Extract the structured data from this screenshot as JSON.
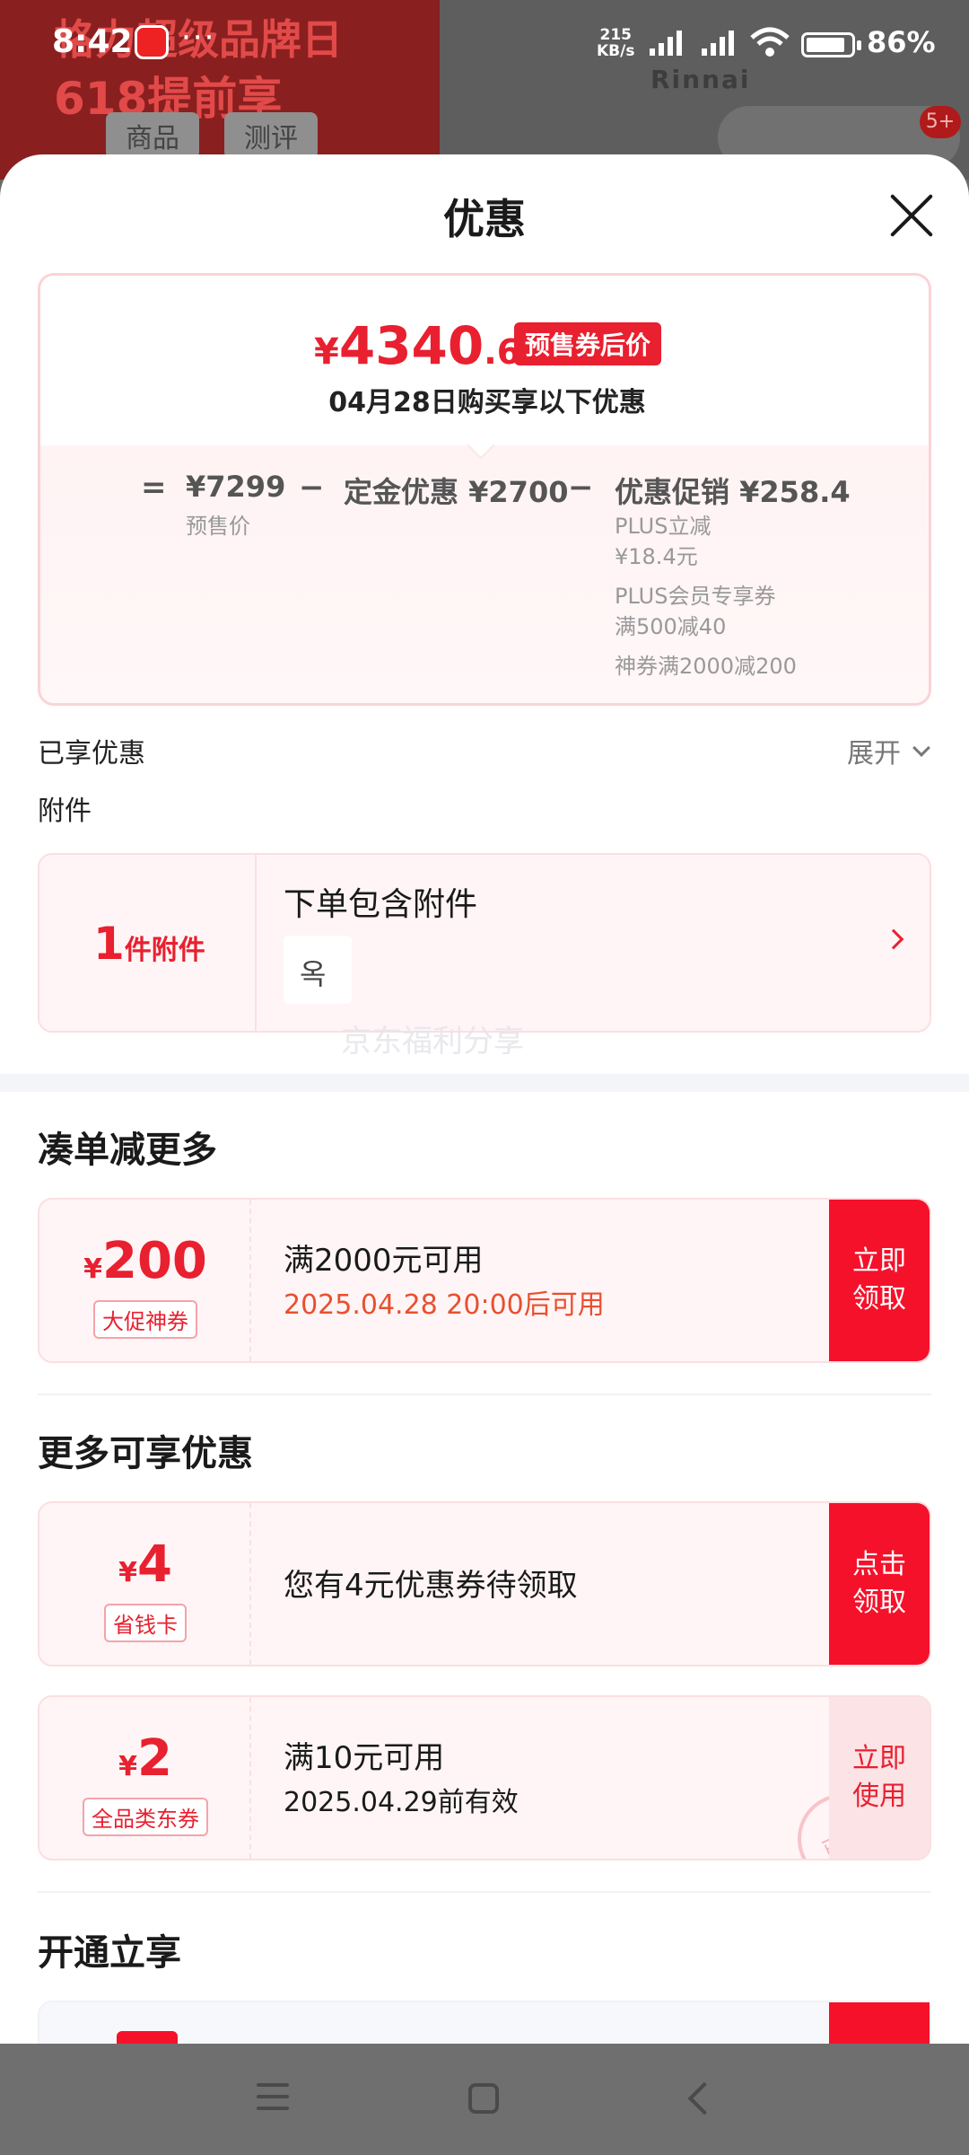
{
  "status_bar": {
    "time": "8:42",
    "more": "···",
    "net_speed_value": "215",
    "net_speed_unit": "KB/s",
    "battery": "86%"
  },
  "background": {
    "banner_line1": "格力超级品牌日",
    "banner_line2": "618提前享",
    "brand": "Rinnai",
    "tab1": "商品",
    "tab2": "测评",
    "badge": "5+"
  },
  "sheet": {
    "title": "优惠",
    "summary": {
      "currency": "¥",
      "price_int": "4340",
      "price_dec": ".6",
      "tag": "预售券后价",
      "subtitle": "04月28日购买享以下优惠",
      "eq": "=",
      "minus": "−",
      "presale_price": "¥7299",
      "presale_label": "预售价",
      "deposit_discount": "定金优惠 ¥2700",
      "promo_discount": "优惠促销 ¥258.4",
      "promo_items": [
        "PLUS立减",
        "¥18.4元",
        "PLUS会员专享券",
        "满500减40",
        "神券满2000减200"
      ]
    },
    "enjoyed_label": "已享优惠",
    "expand_label": "展开",
    "accessory_label": "附件",
    "accessory": {
      "count": "1",
      "count_unit": "件附件",
      "title": "下单包含附件",
      "thumb_glyph": "옥"
    },
    "watermark": "京东福利分享",
    "section_more": "凑单减更多",
    "section_extra": "更多可享优惠",
    "section_open": "开通立享",
    "coupons": [
      {
        "currency": "¥",
        "amount": "200",
        "tag": "大促神券",
        "condition": "满2000元可用",
        "note": "2025.04.28 20:00后可用",
        "action_line1": "立即",
        "action_line2": "领取"
      },
      {
        "currency": "¥",
        "amount": "4",
        "tag": "省钱卡",
        "condition": "您有4元优惠券待领取",
        "note": "",
        "action_line1": "点击",
        "action_line2": "领取"
      },
      {
        "currency": "¥",
        "amount": "2",
        "tag": "全品类东券",
        "condition": "满10元可用",
        "note": "2025.04.29前有效",
        "action_line1": "立即",
        "action_line2": "使用",
        "stamp": "已领"
      }
    ]
  },
  "colors": {
    "accent_red": "#e8202f",
    "action_red": "#f5112a",
    "card_bg": "#fff5f6"
  }
}
